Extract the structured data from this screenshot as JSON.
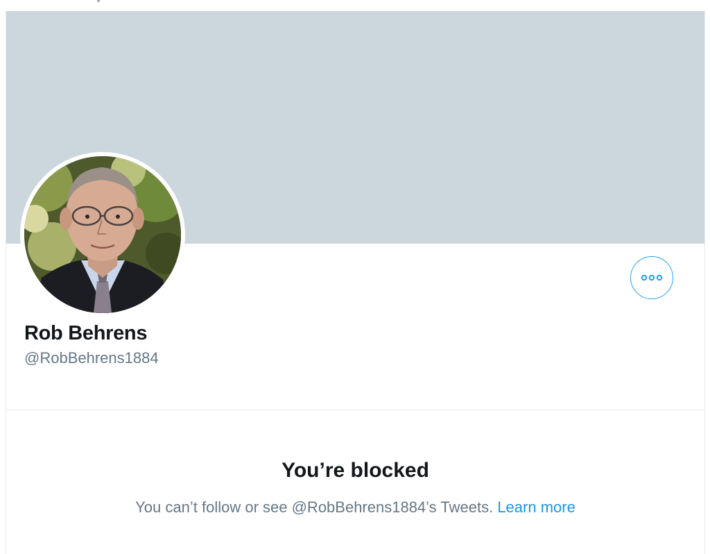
{
  "colors": {
    "banner": "#ccd6dd",
    "accent": "#1da1f2",
    "link": "#1b95e0",
    "primary_text": "#14171a",
    "secondary_text": "#657786",
    "border": "#e6ecf0"
  },
  "profile": {
    "display_name": "Rob Behrens",
    "handle": "@RobBehrens1884",
    "avatar_icon": "profile-photo",
    "more_icon": "more-options-icon"
  },
  "blocked": {
    "title": "You’re blocked",
    "message": "You can’t follow or see @RobBehrens1884’s Tweets.",
    "learn_more": "Learn more"
  }
}
